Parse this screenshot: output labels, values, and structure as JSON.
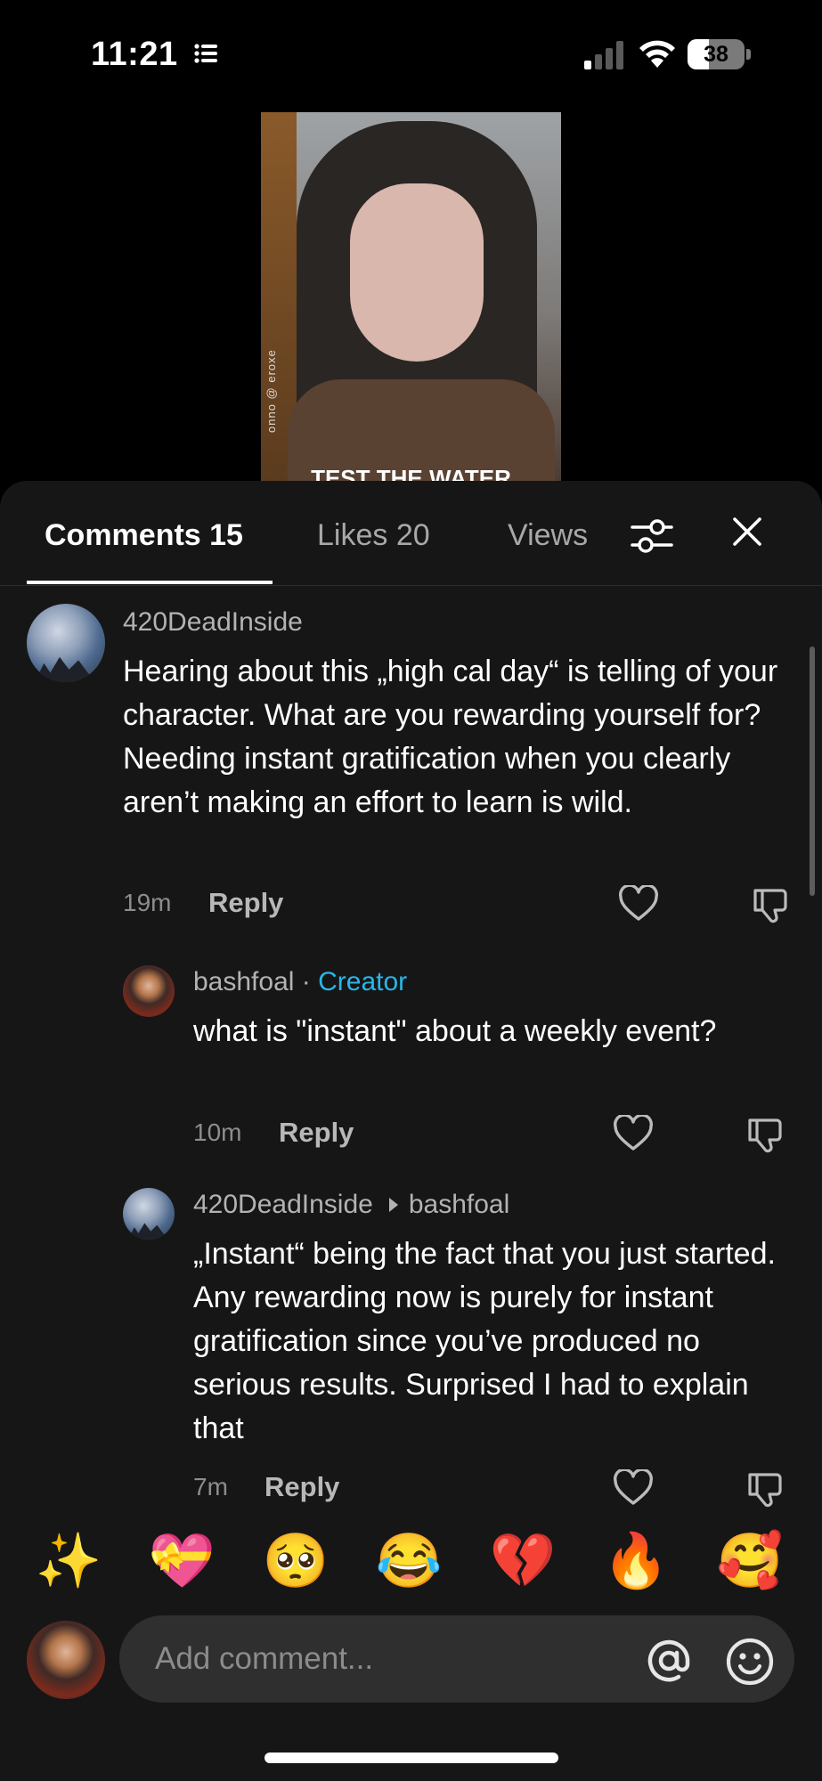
{
  "status_bar": {
    "time": "11:21",
    "battery_level": "38"
  },
  "video": {
    "watermark": "onno @ eroxe",
    "caption_text": "TEST THE WATER"
  },
  "tabs": [
    {
      "label": "Comments 15"
    },
    {
      "label": "Likes 20"
    },
    {
      "label": "Views"
    }
  ],
  "comments": [
    {
      "username": "420DeadInside",
      "text": "Hearing about this „high cal day“ is telling of your character. What are you rewarding yourself for? Needing instant gratification when you clearly aren’t making an effort to learn is wild.",
      "time": "19m",
      "reply_label": "Reply"
    },
    {
      "username": "bashfoal",
      "separator": "·",
      "badge": "Creator",
      "text": "what is \"instant\" about a weekly event?",
      "time": "10m",
      "reply_label": "Reply"
    },
    {
      "username": "420DeadInside",
      "reply_to": "bashfoal",
      "text": "„Instant“ being the fact that you just started. Any rewarding now is purely for instant gratification since you’ve produced no serious results. Surprised I had to explain that",
      "time": "7m",
      "reply_label": "Reply"
    }
  ],
  "emojis": [
    "✨",
    "💝",
    "🥺",
    "😂",
    "💔",
    "🔥",
    "🥰"
  ],
  "compose": {
    "placeholder": "Add comment..."
  },
  "colors": {
    "sheet_bg": "#161616",
    "creator": "#29b6e8",
    "input_bg": "#2f2f2f"
  }
}
